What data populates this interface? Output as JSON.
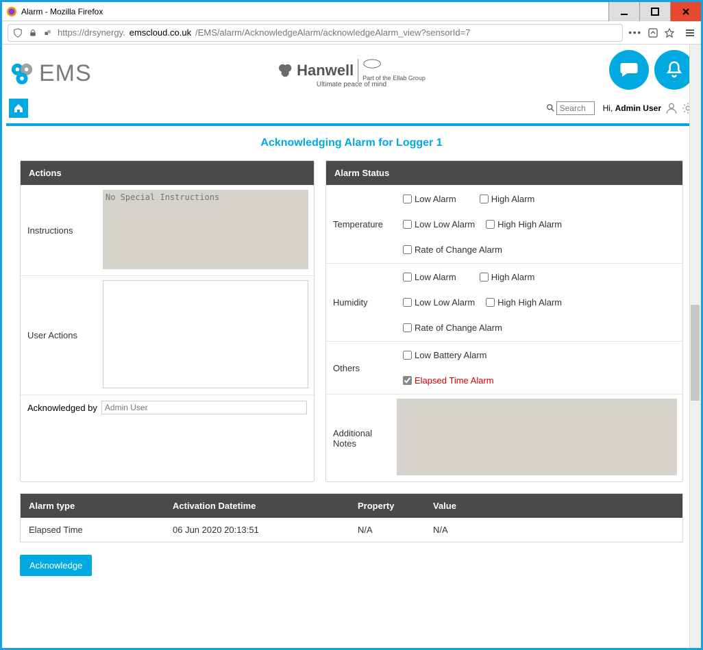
{
  "window": {
    "title": "Alarm - Mozilla Firefox"
  },
  "url": {
    "prefix": "https://drsynergy.",
    "domain": "emscloud.co.uk",
    "path": "/EMS/alarm/AcknowledgeAlarm/acknowledgeAlarm_view?sensorId=7"
  },
  "brand": {
    "ems": "EMS",
    "hanwell": "Hanwell",
    "tagline": "Ultimate peace of mind",
    "ellab": "Part of the Ellab Group"
  },
  "search": {
    "placeholder": "Search"
  },
  "user": {
    "greeting": "Hi,",
    "name": "Admin User"
  },
  "pageTitle": "Acknowledging Alarm for Logger 1",
  "actions": {
    "header": "Actions",
    "instructionsLabel": "Instructions",
    "instructionsPlaceholder": "No Special Instructions",
    "userActionsLabel": "User Actions",
    "ackByLabel": "Acknowledged by",
    "ackByValue": "Admin User"
  },
  "status": {
    "header": "Alarm Status",
    "groups": {
      "temperature": {
        "label": "Temperature",
        "low": "Low Alarm",
        "high": "High Alarm",
        "lowlow": "Low Low Alarm",
        "highhigh": "High High Alarm",
        "rate": "Rate of Change Alarm"
      },
      "humidity": {
        "label": "Humidity",
        "low": "Low Alarm",
        "high": "High Alarm",
        "lowlow": "Low Low Alarm",
        "highhigh": "High High Alarm",
        "rate": "Rate of Change Alarm"
      },
      "others": {
        "label": "Others",
        "battery": "Low Battery Alarm",
        "elapsed": "Elapsed Time Alarm"
      },
      "notes": {
        "label": "Additional Notes"
      }
    }
  },
  "table": {
    "headers": {
      "type": "Alarm type",
      "dt": "Activation Datetime",
      "prop": "Property",
      "val": "Value"
    },
    "row": {
      "type": "Elapsed Time",
      "dt": "06 Jun 2020 20:13:51",
      "prop": "N/A",
      "val": "N/A"
    }
  },
  "ackButton": "Acknowledge"
}
